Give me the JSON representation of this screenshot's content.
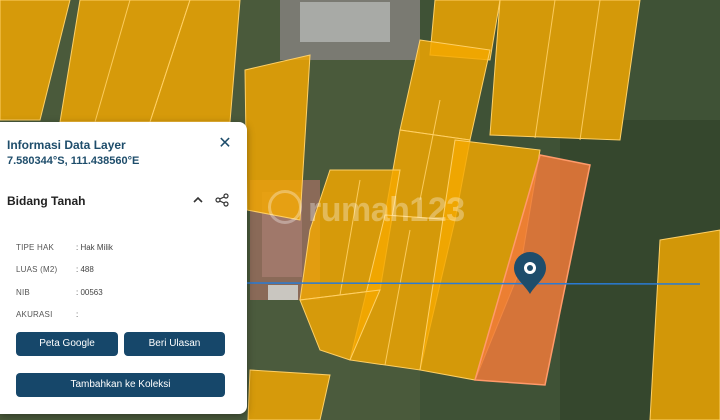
{
  "panel": {
    "title": "Informasi Data Layer",
    "coordinates": "7.580344°S, 111.438560°E",
    "close_icon": "close-icon",
    "section_title": "Bidang Tanah",
    "collapse_icon": "chevron-up-icon",
    "share_icon": "share-icon",
    "attributes": [
      {
        "key": "TIPE HAK",
        "value": ": Hak Milik"
      },
      {
        "key": "LUAS (M2)",
        "value": ": 488"
      },
      {
        "key": "NIB",
        "value": ": 00563"
      },
      {
        "key": "AKURASI",
        "value": ":"
      }
    ],
    "buttons": {
      "google": "Peta Google",
      "review": "Beri Ulasan",
      "collection": "Tambahkan ke Koleksi"
    }
  },
  "watermark": "rumah123",
  "map": {
    "parcel_color": "#f5a800",
    "selected_parcel_color": "#f07a3a",
    "line_color": "#2a7bd4",
    "marker_icon": "location-pin-icon"
  }
}
